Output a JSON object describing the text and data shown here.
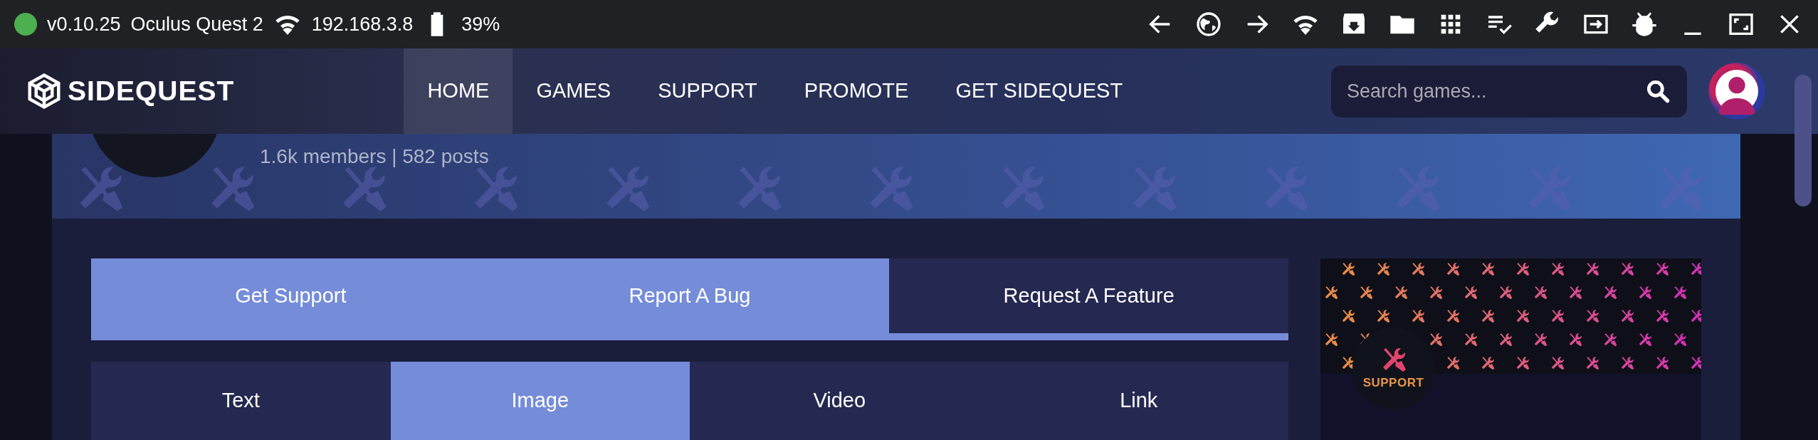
{
  "status_bar": {
    "connected": true,
    "version": "v0.10.25",
    "device": "Oculus Quest 2",
    "ip": "192.168.3.8",
    "battery": "39%"
  },
  "navbar": {
    "logo": "SIDEQUEST",
    "items": [
      {
        "label": "HOME",
        "selected": true
      },
      {
        "label": "GAMES",
        "selected": false
      },
      {
        "label": "SUPPORT",
        "selected": false
      },
      {
        "label": "PROMOTE",
        "selected": false
      },
      {
        "label": "GET SIDEQUEST",
        "selected": false
      }
    ],
    "search": {
      "placeholder": "Search games..."
    }
  },
  "community": {
    "stats": "1.6k members | 582 posts"
  },
  "category_tabs": [
    {
      "label": "Get Support",
      "selected": false
    },
    {
      "label": "Report A Bug",
      "selected": false
    },
    {
      "label": "Request A Feature",
      "selected": true
    }
  ],
  "post_type_tabs": [
    {
      "label": "Text",
      "selected": false
    },
    {
      "label": "Image",
      "selected": true
    },
    {
      "label": "Video",
      "selected": false
    },
    {
      "label": "Link",
      "selected": false
    }
  ],
  "side_card": {
    "badge": "SUPPORT"
  }
}
